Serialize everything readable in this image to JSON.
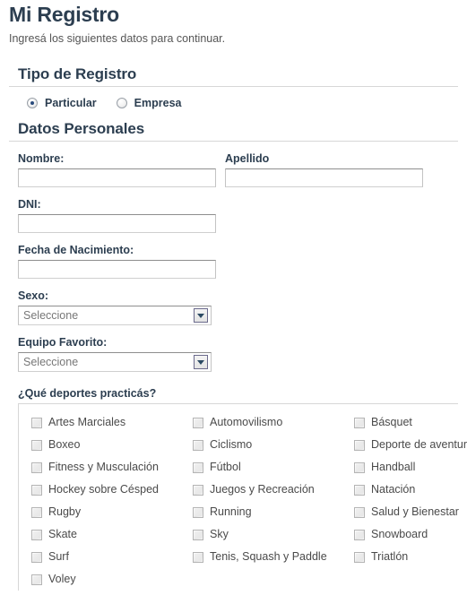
{
  "header": {
    "title": "Mi Registro",
    "subtitle": "Ingresá los siguientes datos para continuar."
  },
  "colors": {
    "heading": "#2c3e50",
    "rule": "#d7d7d7",
    "radio_accent": "#2a4b7c",
    "placeholder_text": "#777777",
    "body_text": "#4a4a4a"
  },
  "registro_type": {
    "section_title": "Tipo de Registro",
    "options": [
      {
        "label": "Particular",
        "selected": true
      },
      {
        "label": "Empresa",
        "selected": false
      }
    ]
  },
  "datos_personales": {
    "section_title": "Datos Personales",
    "nombre": {
      "label": "Nombre:",
      "value": "",
      "placeholder": ""
    },
    "apellido": {
      "label": "Apellido",
      "value": "",
      "placeholder": ""
    },
    "dni": {
      "label": "DNI:",
      "value": "",
      "placeholder": ""
    },
    "fecha_nacimiento": {
      "label": "Fecha de Nacimiento:",
      "value": "",
      "placeholder": ""
    },
    "sexo": {
      "label": "Sexo:",
      "selected": "Seleccione",
      "arrow_icon": "chevron-down-icon"
    },
    "equipo_favorito": {
      "label": "Equipo Favorito:",
      "selected": "Seleccione",
      "arrow_icon": "chevron-down-icon"
    }
  },
  "deportes": {
    "legend": "¿Qué deportes practicás?",
    "columns": [
      [
        {
          "label": "Artes Marciales",
          "checked": false
        },
        {
          "label": "Boxeo",
          "checked": false
        },
        {
          "label": "Fitness y Musculación",
          "checked": false
        },
        {
          "label": "Hockey sobre Césped",
          "checked": false
        },
        {
          "label": "Rugby",
          "checked": false
        },
        {
          "label": "Skate",
          "checked": false
        },
        {
          "label": "Surf",
          "checked": false
        },
        {
          "label": "Voley",
          "checked": false
        }
      ],
      [
        {
          "label": "Automovilismo",
          "checked": false
        },
        {
          "label": "Ciclismo",
          "checked": false
        },
        {
          "label": "Fútbol",
          "checked": false
        },
        {
          "label": "Juegos y Recreación",
          "checked": false
        },
        {
          "label": "Running",
          "checked": false
        },
        {
          "label": "Sky",
          "checked": false
        },
        {
          "label": "Tenis, Squash y Paddle",
          "checked": false
        }
      ],
      [
        {
          "label": "Básquet",
          "checked": false
        },
        {
          "label": "Deporte de aventura",
          "checked": false
        },
        {
          "label": "Handball",
          "checked": false
        },
        {
          "label": "Natación",
          "checked": false
        },
        {
          "label": "Salud y Bienestar",
          "checked": false
        },
        {
          "label": "Snowboard",
          "checked": false
        },
        {
          "label": "Triatlón",
          "checked": false
        }
      ]
    ]
  }
}
